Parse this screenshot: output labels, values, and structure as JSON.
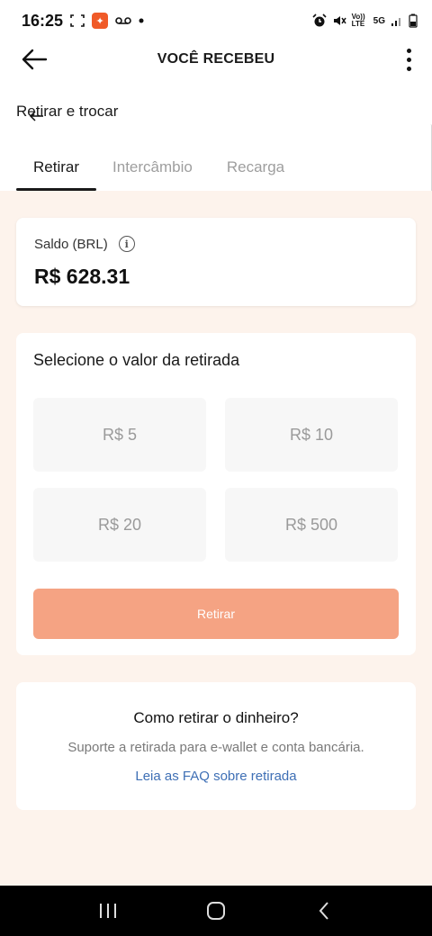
{
  "status_bar": {
    "time": "16:25",
    "network_text": "5G",
    "volte_text": "Vo)) LTE"
  },
  "header": {
    "title": "VOCÊ RECEBEU"
  },
  "subheader": {
    "label": "Retirar e trocar"
  },
  "tabs": [
    {
      "label": "Retirar",
      "active": true
    },
    {
      "label": "Intercâmbio",
      "active": false
    },
    {
      "label": "Recarga",
      "active": false
    }
  ],
  "balance": {
    "label": "Saldo (BRL)",
    "info_icon": "i",
    "value": "R$ 628.31"
  },
  "withdraw": {
    "title": "Selecione o valor da retirada",
    "amounts": [
      "R$ 5",
      "R$ 10",
      "R$ 20",
      "R$ 500"
    ],
    "button_label": "Retirar"
  },
  "help": {
    "title": "Como retirar o dinheiro?",
    "description": "Suporte a retirada para e-wallet e conta bancária.",
    "link": "Leia as FAQ sobre retirada"
  },
  "colors": {
    "accent": "#f5a383",
    "background": "#fdf3ec",
    "link": "#3e6fb5"
  }
}
